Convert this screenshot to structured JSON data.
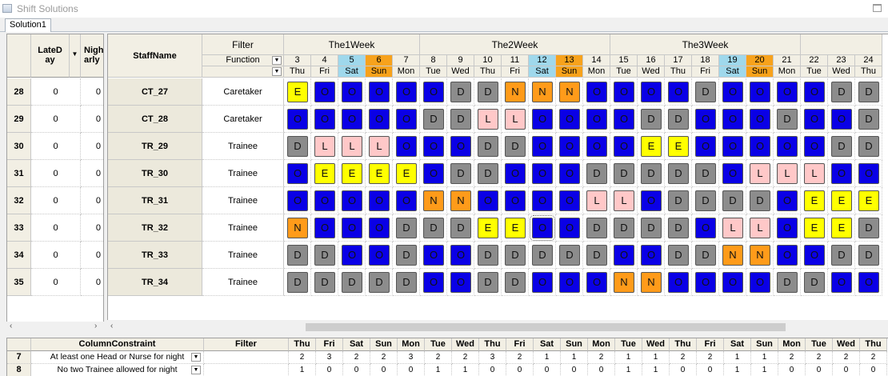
{
  "window": {
    "title": "Shift Solutions"
  },
  "tabs": [
    {
      "label": "Solution1"
    }
  ],
  "left_grid": {
    "headers": [
      "LateD\nay",
      "Night\narly"
    ],
    "rows": [
      {
        "row_no": "28",
        "late_day": "0",
        "night_early": "0"
      },
      {
        "row_no": "29",
        "late_day": "0",
        "night_early": "0"
      },
      {
        "row_no": "30",
        "late_day": "0",
        "night_early": "0"
      },
      {
        "row_no": "31",
        "late_day": "0",
        "night_early": "0"
      },
      {
        "row_no": "32",
        "late_day": "0",
        "night_early": "0"
      },
      {
        "row_no": "33",
        "late_day": "0",
        "night_early": "0"
      },
      {
        "row_no": "34",
        "late_day": "0",
        "night_early": "0"
      },
      {
        "row_no": "35",
        "late_day": "0",
        "night_early": "0"
      }
    ]
  },
  "main_grid": {
    "staff_header": "StaffName",
    "filter_label": "Filter",
    "function_label": "Function",
    "weeks": [
      "The1Week",
      "The2Week",
      "The3Week"
    ],
    "days": [
      {
        "num": "3",
        "dow": "Thu",
        "wknd": ""
      },
      {
        "num": "4",
        "dow": "Fri",
        "wknd": ""
      },
      {
        "num": "5",
        "dow": "Sat",
        "wknd": "sat"
      },
      {
        "num": "6",
        "dow": "Sun",
        "wknd": "sun"
      },
      {
        "num": "7",
        "dow": "Mon",
        "wknd": ""
      },
      {
        "num": "8",
        "dow": "Tue",
        "wknd": ""
      },
      {
        "num": "9",
        "dow": "Wed",
        "wknd": ""
      },
      {
        "num": "10",
        "dow": "Thu",
        "wknd": ""
      },
      {
        "num": "11",
        "dow": "Fri",
        "wknd": ""
      },
      {
        "num": "12",
        "dow": "Sat",
        "wknd": "sat"
      },
      {
        "num": "13",
        "dow": "Sun",
        "wknd": "sun"
      },
      {
        "num": "14",
        "dow": "Mon",
        "wknd": ""
      },
      {
        "num": "15",
        "dow": "Tue",
        "wknd": ""
      },
      {
        "num": "16",
        "dow": "Wed",
        "wknd": ""
      },
      {
        "num": "17",
        "dow": "Thu",
        "wknd": ""
      },
      {
        "num": "18",
        "dow": "Fri",
        "wknd": ""
      },
      {
        "num": "19",
        "dow": "Sat",
        "wknd": "sat"
      },
      {
        "num": "20",
        "dow": "Sun",
        "wknd": "sun"
      },
      {
        "num": "21",
        "dow": "Mon",
        "wknd": ""
      },
      {
        "num": "22",
        "dow": "Tue",
        "wknd": ""
      },
      {
        "num": "23",
        "dow": "Wed",
        "wknd": ""
      },
      {
        "num": "24",
        "dow": "Thu",
        "wknd": ""
      }
    ],
    "staff": [
      {
        "name": "CT_27",
        "function": "Caretaker",
        "shifts": "EOOOOODDNNNOOOODOOOODD"
      },
      {
        "name": "CT_28",
        "function": "Caretaker",
        "shifts": "OOOOODDLLOOOODDOOODOOD"
      },
      {
        "name": "TR_29",
        "function": "Trainee",
        "shifts": "DLLLOOODDOOOOEEOOOOODD"
      },
      {
        "name": "TR_30",
        "function": "Trainee",
        "shifts": "OEEEEODDOOODDDDDOLLLOO"
      },
      {
        "name": "TR_31",
        "function": "Trainee",
        "shifts": "OOOOONNOOOOLLODDDDOEEE"
      },
      {
        "name": "TR_32",
        "function": "Trainee",
        "shifts": "NOOODDDEEOODDDDOLLOEED"
      },
      {
        "name": "TR_33",
        "function": "Trainee",
        "shifts": "DDOODOODDDDDOODDNNOODD"
      },
      {
        "name": "TR_34",
        "function": "Trainee",
        "shifts": "DDDDDOODDOOONNOOOODDOO"
      }
    ]
  },
  "shift_colors": {
    "O": "#0a00e6",
    "D": "#8c8c8c",
    "E": "#ffff00",
    "N": "#ff9b1a",
    "L": "#ffc8c8"
  },
  "bottom_grid": {
    "header": "ColumnConstraint",
    "filter_label": "Filter",
    "rows": [
      {
        "row_no": "7",
        "label": "At least one Head or Nurse for night",
        "values": [
          "2",
          "3",
          "2",
          "2",
          "3",
          "2",
          "2",
          "3",
          "2",
          "1",
          "1",
          "2",
          "1",
          "1",
          "2",
          "2",
          "1",
          "1",
          "2",
          "2",
          "2",
          "2"
        ]
      },
      {
        "row_no": "8",
        "label": "No two Trainee allowed for night",
        "values": [
          "1",
          "0",
          "0",
          "0",
          "0",
          "1",
          "1",
          "0",
          "0",
          "0",
          "0",
          "0",
          "1",
          "1",
          "0",
          "0",
          "1",
          "1",
          "0",
          "0",
          "0",
          "0"
        ]
      }
    ]
  }
}
